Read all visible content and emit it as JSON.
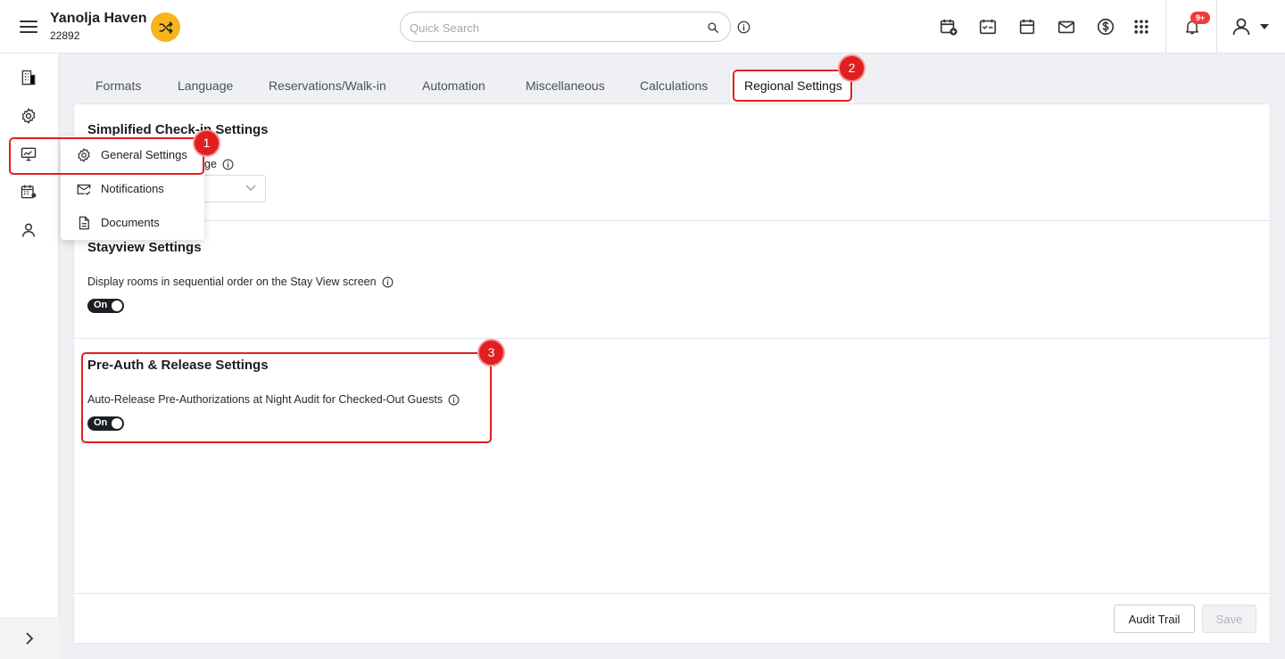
{
  "header": {
    "property_name": "Yanolja Haven",
    "property_id": "22892",
    "search_placeholder": "Quick Search",
    "notification_badge": "9+",
    "icons": [
      "add-booking-icon",
      "checkin-calendar-icon",
      "calendar-icon",
      "mail-icon",
      "dollar-icon",
      "apps-grid-icon",
      "bell-icon",
      "user-icon"
    ],
    "accent_color": "#f6b51a"
  },
  "rail": {
    "items": [
      "building-icon",
      "gear-icon",
      "monitor-icon",
      "calendar-user-icon",
      "person-icon"
    ],
    "expand_icon": "chevron-right-icon"
  },
  "tabs": [
    {
      "label": "Formats"
    },
    {
      "label": "Language"
    },
    {
      "label": "Reservations/Walk-in"
    },
    {
      "label": "Automation"
    },
    {
      "label": "Miscellaneous"
    },
    {
      "label": "Calculations"
    },
    {
      "label": "Regional Settings",
      "active": true
    }
  ],
  "sections": {
    "checkin": {
      "title": "Simplified Check-in Settings",
      "field_label_visible": "ge"
    },
    "stayview": {
      "title": "Stayview Settings",
      "field_label": "Display rooms in sequential order on the Stay View screen",
      "toggle_label": "On"
    },
    "preauth": {
      "title": "Pre-Auth & Release Settings",
      "field_label": "Auto-Release Pre-Authorizations at Night Audit for Checked-Out Guests",
      "toggle_label": "On"
    }
  },
  "menu": {
    "items": [
      {
        "label": "General Settings",
        "icon": "gear-icon"
      },
      {
        "label": "Notifications",
        "icon": "mail-check-icon"
      },
      {
        "label": "Documents",
        "icon": "document-icon"
      }
    ]
  },
  "buttons": {
    "audit_trail": "Audit Trail",
    "save": "Save"
  },
  "annotations": [
    "1",
    "2",
    "3"
  ],
  "annotation_color": "#e02020"
}
